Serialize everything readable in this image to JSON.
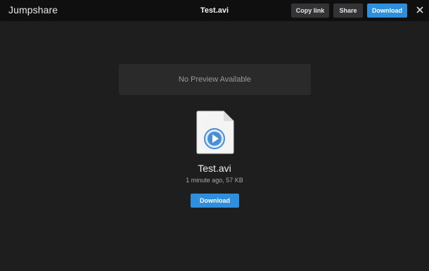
{
  "header": {
    "brand": "Jumpshare",
    "title": "Test.avi",
    "copy_link_label": "Copy link",
    "share_label": "Share",
    "download_label": "Download",
    "close_icon": "close-icon"
  },
  "preview": {
    "message": "No Preview Available"
  },
  "file": {
    "icon": "video-file-icon",
    "name": "Test.avi",
    "meta": "1 minute ago, 57 KB",
    "download_label": "Download"
  },
  "colors": {
    "accent": "#2e8fdf",
    "background": "#1e1e1f",
    "topbar": "#0f0f10"
  }
}
